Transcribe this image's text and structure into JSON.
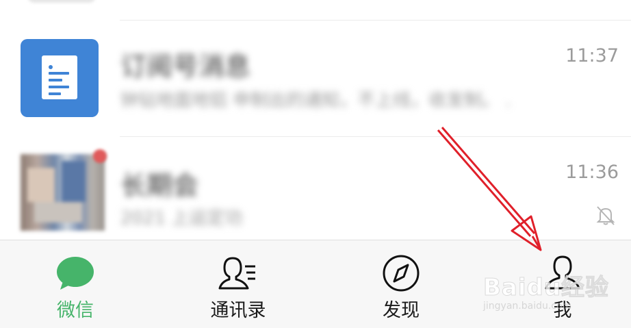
{
  "chats": [
    {
      "title": "订阅号消息",
      "preview": "钟钻地面地铝 申制出的通知，不上线，收发制。 .",
      "time": "11:37"
    },
    {
      "title": "长期会",
      "preview": "2021 上运定功",
      "time": "11:36",
      "muted": true
    }
  ],
  "tabbar": {
    "tabs": [
      {
        "label": "微信",
        "icon": "chat-bubble-icon",
        "active": true
      },
      {
        "label": "通讯录",
        "icon": "contacts-icon",
        "active": false
      },
      {
        "label": "发现",
        "icon": "compass-icon",
        "active": false
      },
      {
        "label": "我",
        "icon": "person-icon",
        "active": false
      }
    ]
  },
  "annotation": {
    "type": "red-arrow",
    "target": "tab-me"
  },
  "watermark": {
    "main": "Baidu经验",
    "sub": "jingyan.baidu.com"
  },
  "colors": {
    "active_tab": "#46b46a",
    "subscription_avatar": "#3f84d6",
    "arrow": "#e0202a"
  }
}
